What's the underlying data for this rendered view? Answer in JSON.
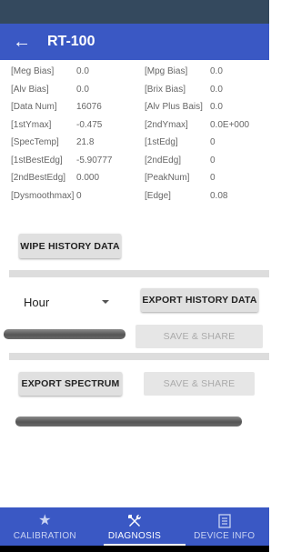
{
  "app": {
    "title": "RT-100",
    "back_icon": "arrow-left-icon"
  },
  "params": [
    [
      "[Meg Bias]",
      "0.0",
      "[Mpg Bias]",
      "0.0"
    ],
    [
      "[Alv Bias]",
      "0.0",
      "[Brix Bias]",
      "0.0"
    ],
    [
      "[Data Num]",
      "16076",
      "[Alv Plus Bais]",
      "0.0"
    ],
    [
      "[1stYmax]",
      "-0.475",
      "[2ndYmax]",
      "0.0E+000"
    ],
    [
      "[SpecTemp]",
      "21.8",
      "[1stEdg]",
      "0"
    ],
    [
      "[1stBestEdg]",
      "-5.90777",
      "[2ndEdg]",
      "0"
    ],
    [
      "[2ndBestEdg]",
      "0.000",
      "[PeakNum]",
      "0"
    ],
    [
      "[Dysmoothmax]",
      "0",
      "[Edge]",
      "0.08"
    ]
  ],
  "buttons": {
    "wipe": "WIPE HISTORY DATA",
    "export_history": "EXPORT HISTORY DATA",
    "save_share_1": "SAVE & SHARE",
    "export_spectrum": "EXPORT SPECTRUM",
    "save_share_2": "SAVE & SHARE"
  },
  "period_select": {
    "value": "Hour"
  },
  "bottom_nav": [
    {
      "label": "CALIBRATION",
      "icon": "star-icon",
      "active": false
    },
    {
      "label": "DIAGNOSIS",
      "icon": "tools-icon",
      "active": true
    },
    {
      "label": "DEVICE INFO",
      "icon": "document-icon",
      "active": false
    }
  ],
  "colors": {
    "primary": "#3a58c4",
    "status_bar": "#34495e"
  }
}
